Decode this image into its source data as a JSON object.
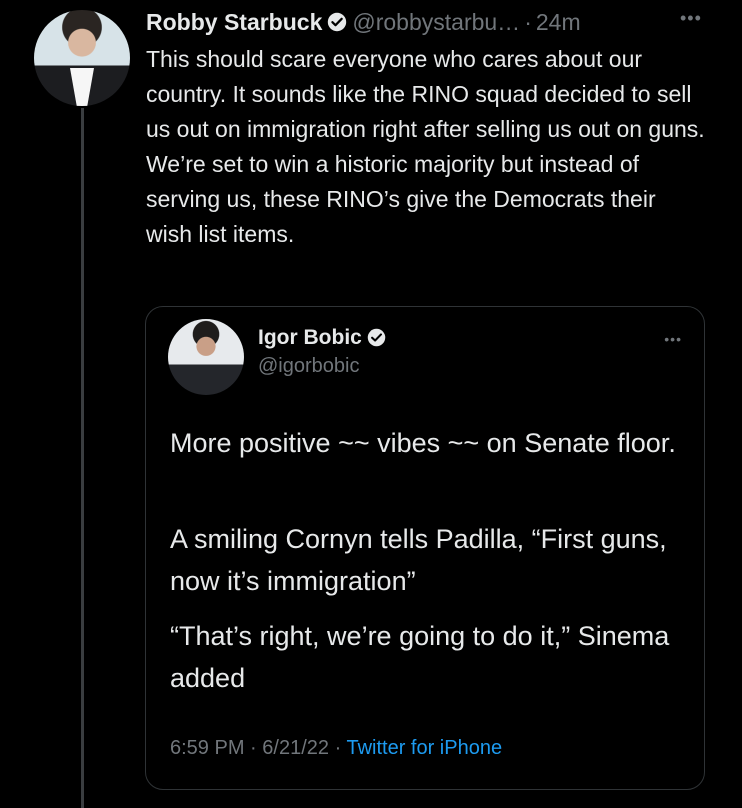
{
  "tweet": {
    "author_name": "Robby Starbuck",
    "handle": "@robbystarbu…",
    "separator": "·",
    "time": "24m",
    "more": "•••",
    "text": "This should scare everyone who cares about our country. It sounds like the RINO squad decided to sell us out on immigration right after selling us out on guns. We’re set to win a historic majority but instead of serving us, these RINO’s give the Democrats their wish list items."
  },
  "quote": {
    "author_name": "Igor Bobic",
    "handle": "@igorbobic",
    "more": "•••",
    "paragraph_1": "More positive ~~ vibes ~~ on Senate floor.",
    "paragraph_2": "A smiling Cornyn tells Padilla, “First guns, now it’s immigration”",
    "paragraph_3": "“That’s right, we’re going to do it,” Sinema added",
    "time": "6:59 PM",
    "date": "6/21/22",
    "separator_1": "·",
    "separator_2": "·",
    "source": "Twitter for iPhone"
  },
  "colors": {
    "background": "#000000",
    "text": "#e7e9ea",
    "muted": "#71767b",
    "link": "#1d9bf0",
    "border": "#2f3336"
  },
  "icons": {
    "verified": "verified-badge-icon",
    "more": "more-options-icon"
  }
}
